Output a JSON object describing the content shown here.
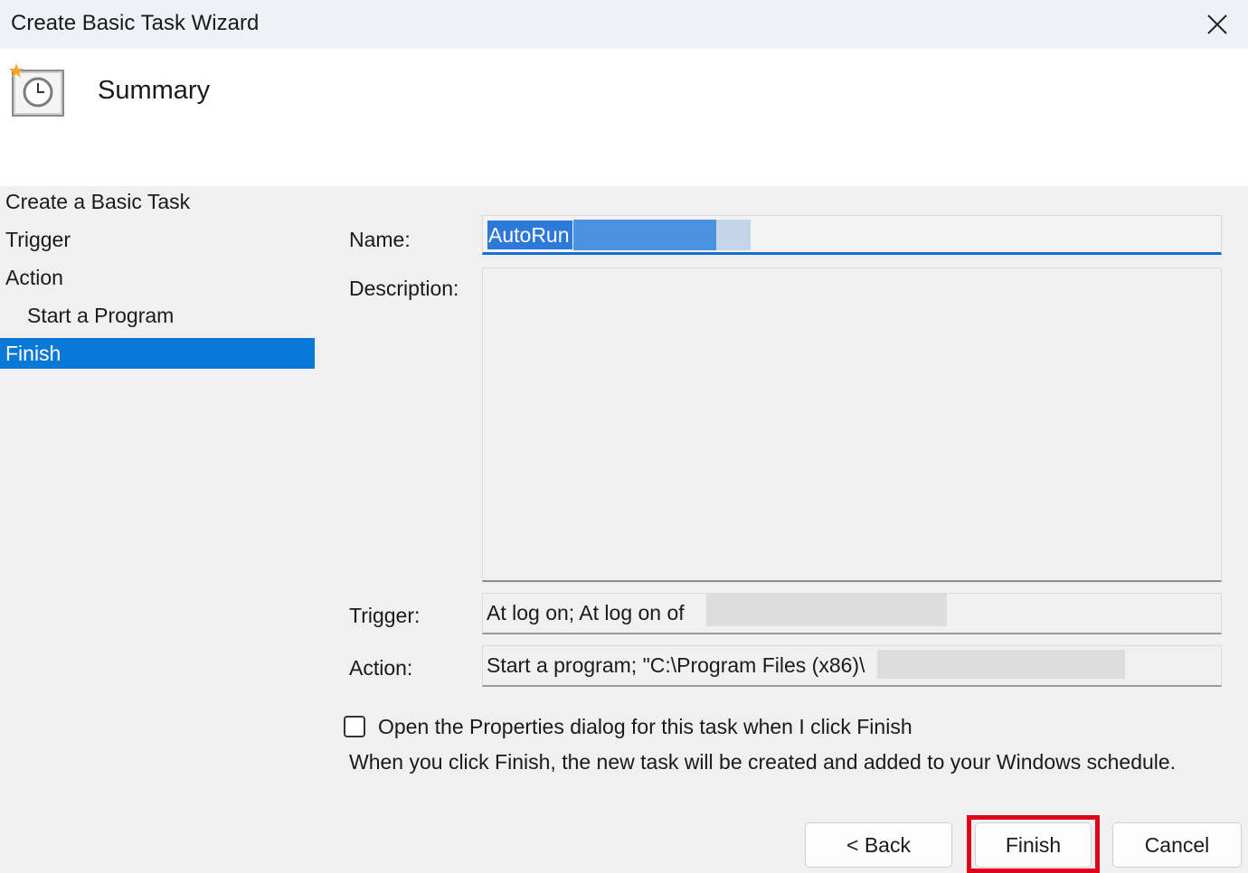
{
  "window": {
    "title": "Create Basic Task Wizard",
    "close_icon": "close-icon"
  },
  "header": {
    "title": "Summary",
    "icon": "task-scheduler-clock-icon"
  },
  "nav": {
    "items": [
      {
        "label": "Create a Basic Task",
        "sub": false,
        "selected": false
      },
      {
        "label": "Trigger",
        "sub": false,
        "selected": false
      },
      {
        "label": "Action",
        "sub": false,
        "selected": false
      },
      {
        "label": "Start a Program",
        "sub": true,
        "selected": false
      },
      {
        "label": "Finish",
        "sub": false,
        "selected": true
      }
    ]
  },
  "form": {
    "name_label": "Name:",
    "name_value": "AutoRun",
    "description_label": "Description:",
    "description_value": "",
    "trigger_label": "Trigger:",
    "trigger_value": "At log on; At log on of",
    "action_label": "Action:",
    "action_value": "Start a program; \"C:\\Program Files (x86)\\"
  },
  "options": {
    "open_properties_label": "Open the Properties dialog for this task when I click Finish",
    "open_properties_checked": false,
    "info_text": "When you click Finish, the new task will be created and added to your Windows schedule."
  },
  "buttons": {
    "back": "< Back",
    "finish": "Finish",
    "cancel": "Cancel"
  },
  "colors": {
    "selection": "#0a78d7",
    "highlight_box": "#e0001b",
    "focus_underline": "#1a6ccd"
  }
}
